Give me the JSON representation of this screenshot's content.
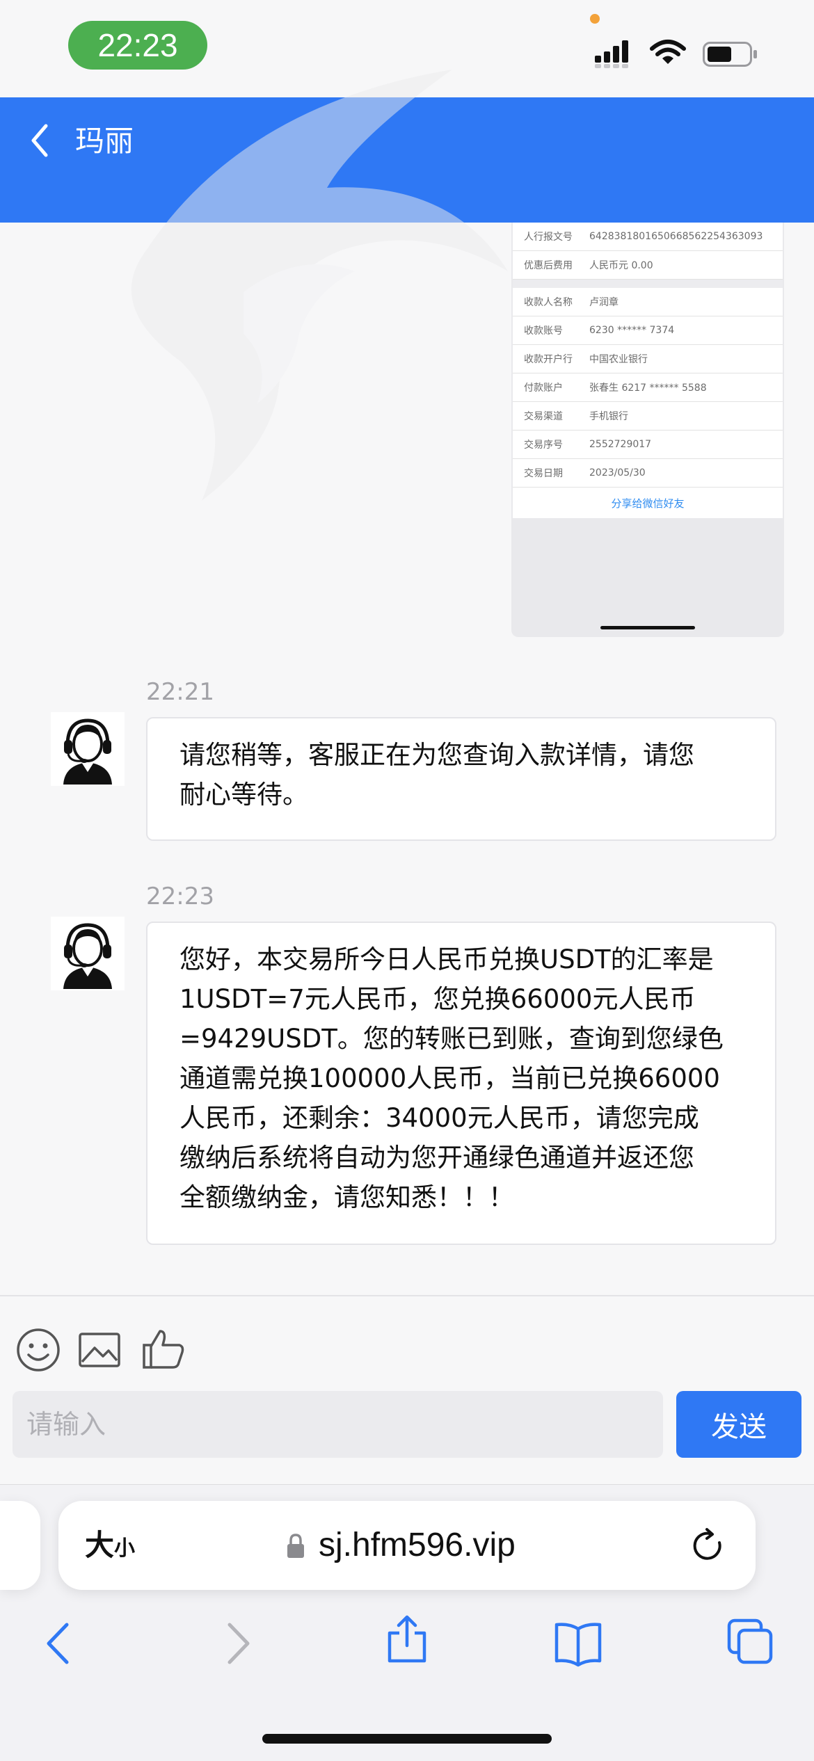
{
  "status_bar": {
    "time": "22:23"
  },
  "header": {
    "title": "玛丽"
  },
  "receipt": {
    "rows_top": [
      {
        "label": "人行报文号",
        "value": "6428381801650668562254363093"
      },
      {
        "label": "优惠后费用",
        "value": "人民币元 0.00"
      }
    ],
    "rows": [
      {
        "label": "收款人名称",
        "value": "卢润章"
      },
      {
        "label": "收款账号",
        "value": "6230 ****** 7374"
      },
      {
        "label": "收款开户行",
        "value": "中国农业银行"
      },
      {
        "label": "付款账户",
        "value": "张春生 6217 ****** 5588"
      },
      {
        "label": "交易渠道",
        "value": "手机银行"
      },
      {
        "label": "交易序号",
        "value": "2552729017"
      },
      {
        "label": "交易日期",
        "value": "2023/05/30"
      }
    ],
    "share_label": "分享给微信好友"
  },
  "messages": [
    {
      "time": "22:21",
      "lines": [
        "请您稍等，客服正在为您查询入款详情，请您",
        "耐心等待。"
      ]
    },
    {
      "time": "22:23",
      "lines": [
        "您好，本交易所今日人民币兑换USDT的汇率是",
        "1USDT=7元人民币，您兑换66000元人民币",
        "=9429USDT。您的转账已到账，查询到您绿色",
        "通道需兑换100000人民币，当前已兑换66000",
        "人民币，还剩余：34000元人民币，请您完成",
        "缴纳后系统将自动为您开通绿色通道并返还您",
        "全额缴纳金，请您知悉！！！"
      ]
    }
  ],
  "input": {
    "placeholder": "请输入",
    "value": "",
    "send_label": "发送"
  },
  "browser": {
    "text_size_big": "大",
    "text_size_small": "小",
    "url": "sj.hfm596.vip"
  },
  "colors": {
    "header": "#2f78f4",
    "send_button": "#2f78f4",
    "time_pill": "#4caf50"
  },
  "icons": {
    "toolbar": [
      "emoji-icon",
      "image-icon",
      "thumbs-up-icon"
    ],
    "browser_nav": [
      "back-arrow-icon",
      "forward-arrow-icon",
      "share-icon",
      "bookmarks-icon",
      "tabs-icon"
    ]
  }
}
